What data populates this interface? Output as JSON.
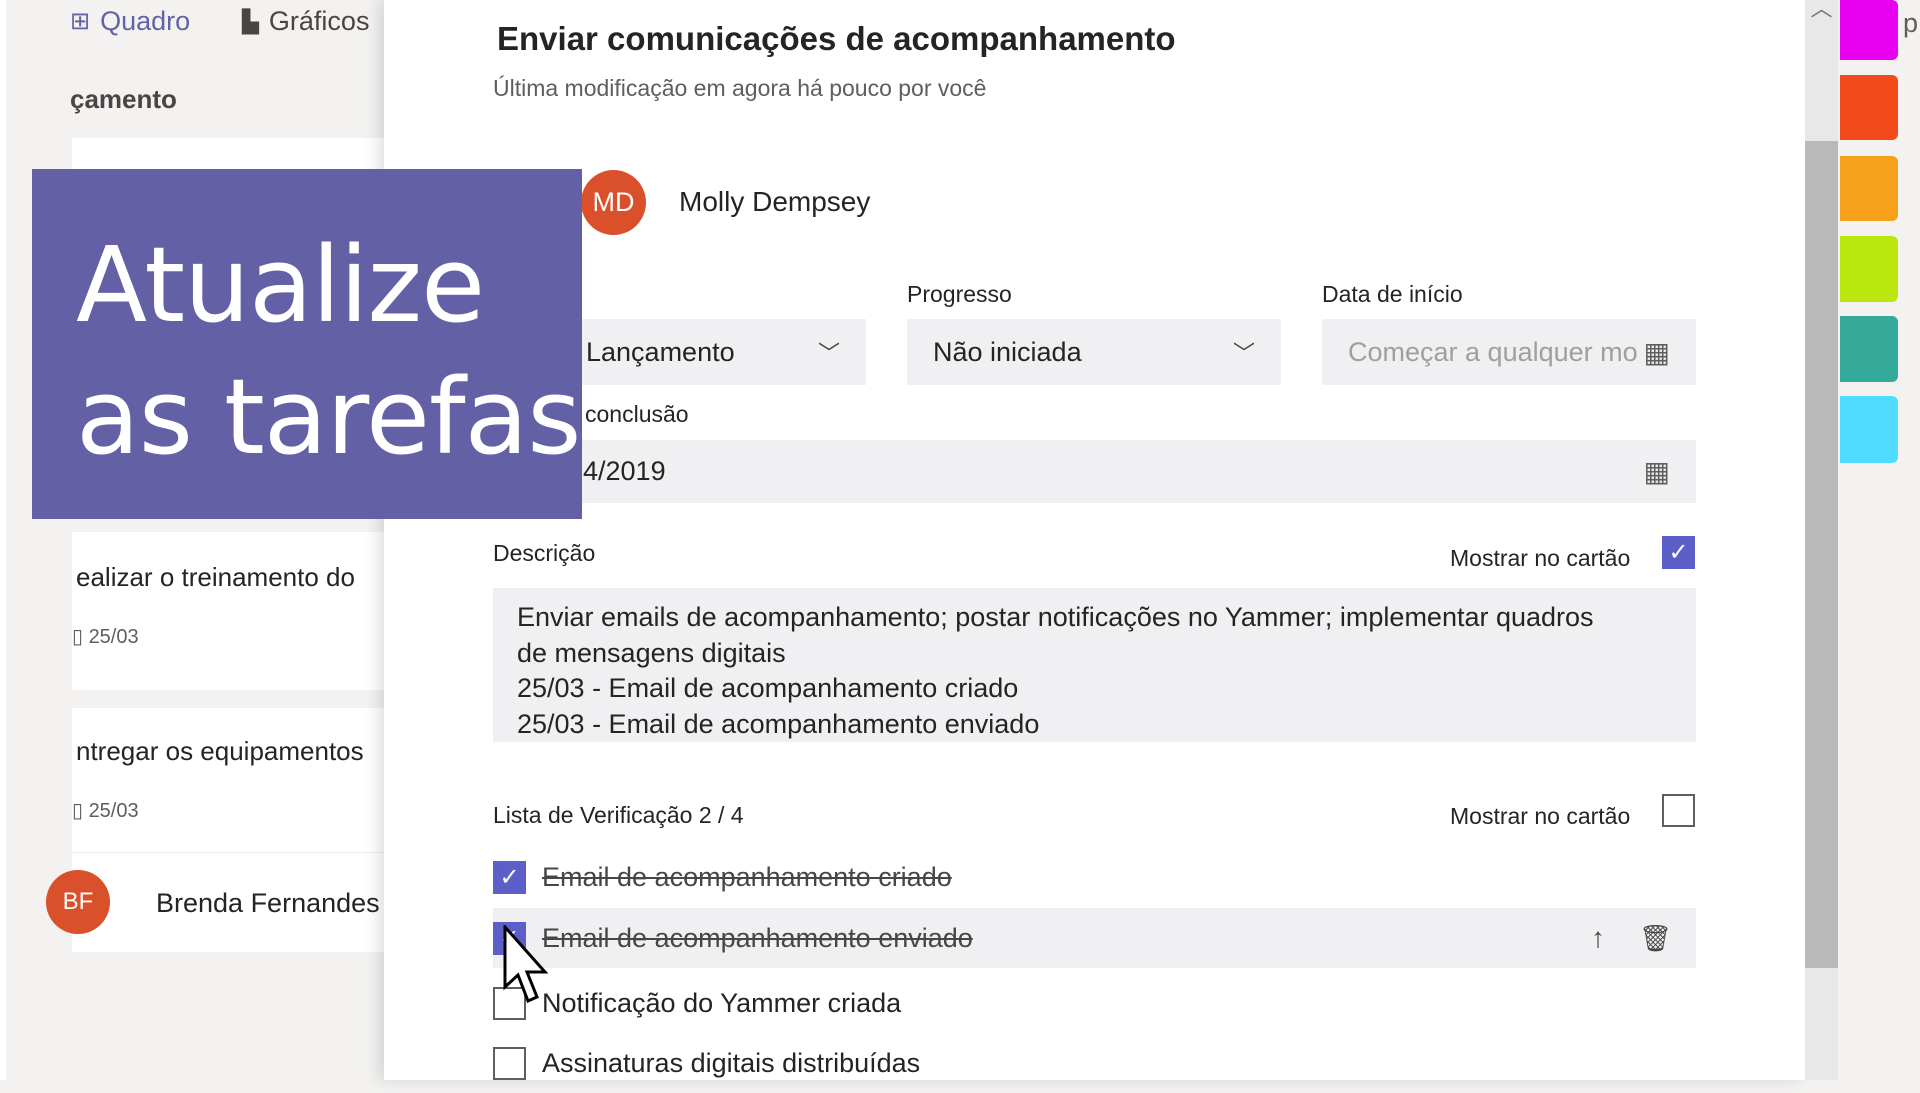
{
  "board": {
    "tabs": [
      {
        "label": "Quadro",
        "icon": "board-icon",
        "active": true
      },
      {
        "label": "Gráficos",
        "icon": "charts-icon",
        "active": false
      }
    ],
    "bucket_title": "çamento",
    "cards": [
      {
        "title": "ealizar o treinamento do",
        "date": "25/03"
      },
      {
        "title": "ntregar os equipamentos",
        "date": "25/03",
        "assignee_initials": "BF",
        "assignee": "Brenda Fernandes"
      }
    ],
    "right_text": "p"
  },
  "overlay": {
    "line1": "Atualize",
    "line2": "as tarefas",
    "color": "#6360a6"
  },
  "task": {
    "title": "Enviar comunicações de acompanhamento",
    "subtitle": "Última modificação em agora há pouco por você",
    "assignee": {
      "initials": "MD",
      "name": "Molly Dempsey",
      "color": "#d9502b"
    },
    "bucket": {
      "value": "Lançamento"
    },
    "progress": {
      "label": "Progresso",
      "value": "Não iniciada"
    },
    "start_date": {
      "label": "Data de início",
      "placeholder": "Começar a qualquer mo"
    },
    "due_date": {
      "label": "conclusão",
      "value": "4/2019"
    },
    "description": {
      "label": "Descrição",
      "show_on_card_label": "Mostrar no cartão",
      "show_on_card": true,
      "lines": [
        "Enviar emails de acompanhamento; postar notificações no Yammer; implementar quadros",
        "de mensagens digitais",
        "25/03 - Email de acompanhamento criado",
        "25/03 - Email de acompanhamento enviado"
      ]
    },
    "checklist": {
      "label": "Lista de Verificação 2 / 4",
      "show_on_card_label": "Mostrar no cartão",
      "show_on_card": false,
      "items": [
        {
          "text": "Email de acompanhamento criado",
          "checked": true
        },
        {
          "text": "Email de acompanhamento enviado",
          "checked": true
        },
        {
          "text": "Notificação do Yammer criada",
          "checked": false
        },
        {
          "text": "Assinaturas digitais distribuídas",
          "checked": false
        }
      ]
    }
  },
  "label_colors": [
    "#e800f0",
    "#f34a1b",
    "#f6a11b",
    "#bae80e",
    "#35a99a",
    "#4fdcff"
  ],
  "accent": "#5b5fc7"
}
